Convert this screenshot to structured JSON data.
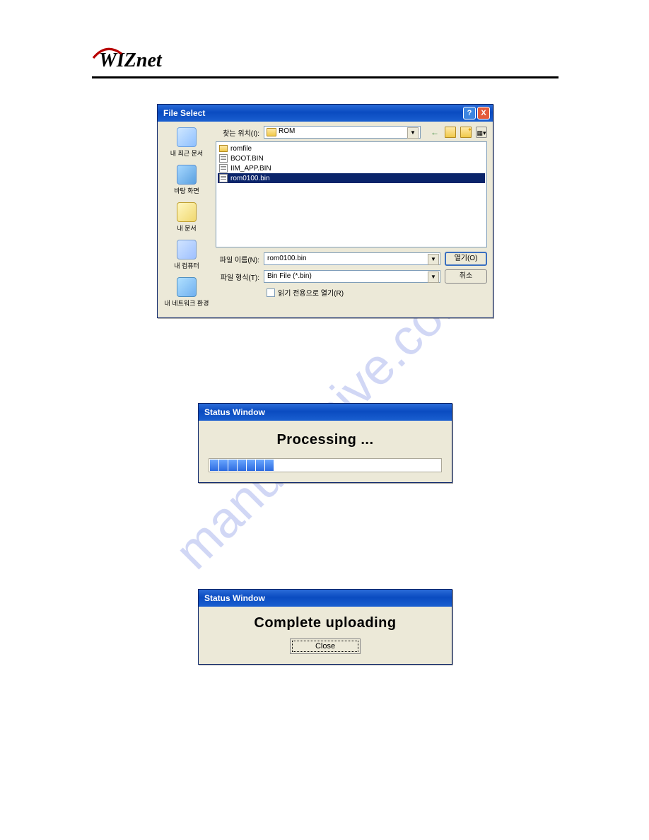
{
  "logo_text": "WIZnet",
  "watermark": "manualshive.com",
  "file_dialog": {
    "title": "File Select",
    "lookin_label": "찾는 위치(I):",
    "lookin_value": "ROM",
    "places": [
      "내 최근 문서",
      "바탕 화면",
      "내 문서",
      "내 컴퓨터",
      "내 네트워크 환경"
    ],
    "files": [
      {
        "name": "romfile",
        "type": "folder",
        "selected": false
      },
      {
        "name": "BOOT.BIN",
        "type": "bin",
        "selected": false
      },
      {
        "name": "IIM_APP.BIN",
        "type": "bin",
        "selected": false
      },
      {
        "name": "rom0100.bin",
        "type": "bin",
        "selected": true
      }
    ],
    "filename_label": "파일 이름(N):",
    "filename_value": "rom0100.bin",
    "filetype_label": "파일 형식(T):",
    "filetype_value": "Bin File (*.bin)",
    "readonly_label": "읽기 전용으로 열기(R)",
    "open_button": "열기(O)",
    "cancel_button": "취소"
  },
  "status_processing": {
    "title": "Status Window",
    "heading": "Processing ...",
    "progress_segments": 7
  },
  "status_complete": {
    "title": "Status Window",
    "heading": "Complete uploading",
    "close_button": "Close"
  }
}
